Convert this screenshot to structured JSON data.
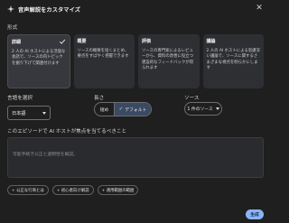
{
  "header": {
    "title": "音声解説をカスタマイズ",
    "close_glyph": "✕"
  },
  "format": {
    "label": "形式",
    "cards": [
      {
        "title": "詳細",
        "desc": "2 人の AI ホストによる活発な会話で、ソースの内トピックを掘り下げて関連付けます",
        "selected": true
      },
      {
        "title": "概要",
        "desc": "ソースの概要を短くまとめ、要点をすばやく把握できます",
        "selected": false
      },
      {
        "title": "評価",
        "desc": "ソースの専門家によるレビューから、資料の改善に役立つ建設的なフィードバックが得られます",
        "selected": false
      },
      {
        "title": "議論",
        "desc": "2 人の AI ホストによる思慮深い議論で、ソースに関するさまざまな視点を明らかにします",
        "selected": false
      }
    ]
  },
  "language": {
    "label": "言語を選択",
    "value": "日本語"
  },
  "length": {
    "label": "長さ",
    "short": "短め",
    "default": "デフォルト",
    "selected": "default"
  },
  "source": {
    "label": "ソース",
    "value": "1 件のソース"
  },
  "focus": {
    "label": "このエピソードで AI ホストが焦点を当てるべきこと",
    "placeholder": "可能手続き公正と透明性を解説。"
  },
  "suggestions": [
    "+ 公正な行商とは",
    "+ 初心者向け解説",
    "+ 適用範囲の範囲"
  ],
  "actions": {
    "generate_label": "生成"
  },
  "colors": {
    "background": "#1f1f1f",
    "card": "#2d2f33",
    "accent": "#8ab4f8",
    "segment_selected": "#3b4a63"
  }
}
